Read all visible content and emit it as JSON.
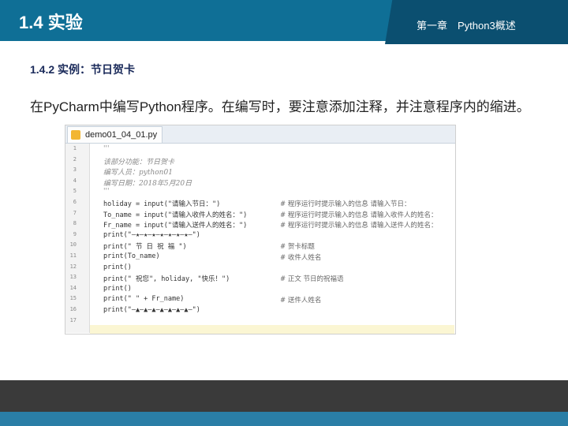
{
  "header": {
    "title": "1.4 实验",
    "chapter": "第一章　Python3概述"
  },
  "section_title": "1.4.2 实例：节日贺卡",
  "paragraph": "在PyCharm中编写Python程序。在编写时，要注意添加注释，并注意程序内的缩进。",
  "editor": {
    "tab_label": "demo01_04_01.py",
    "line_numbers": [
      "1",
      "2",
      "3",
      "4",
      "5",
      "6",
      "7",
      "8",
      "9",
      "10",
      "11",
      "12",
      "13",
      "14",
      "15",
      "16",
      "17"
    ],
    "lines": [
      {
        "code": "'''",
        "comment": ""
      },
      {
        "code": "该部分功能：节日贺卡",
        "comment": ""
      },
      {
        "code": "编写人员：python01",
        "comment": ""
      },
      {
        "code": "编写日期：2018年5月20日",
        "comment": ""
      },
      {
        "code": "'''",
        "comment": ""
      },
      {
        "code": "holiday = input(\"请输入节日：\")",
        "comment": "# 程序运行时提示输入的信息 请输入节日："
      },
      {
        "code": "To_name = input(\"请输入收件人的姓名：\")",
        "comment": "# 程序运行时提示输入的信息 请输入收件人的姓名："
      },
      {
        "code": "Fr_name = input(\"请输入送件人的姓名：\")",
        "comment": "# 程序运行时提示输入的信息 请输入送件人的姓名："
      },
      {
        "code": "print(\"—★—★—★—★—★—★—★—\")",
        "comment": ""
      },
      {
        "code": "print(\"    节    日    祝    福    \")",
        "comment": "# 贺卡标题"
      },
      {
        "code": "print(To_name)",
        "comment": "# 收件人姓名"
      },
      {
        "code": "print()",
        "comment": ""
      },
      {
        "code": "print(\"     祝您\", holiday, \"快乐！\")",
        "comment": "# 正文 节日的祝福语"
      },
      {
        "code": "print()",
        "comment": ""
      },
      {
        "code": "print(\"                    \" + Fr_name)",
        "comment": "# 送件人姓名"
      },
      {
        "code": "print(\"—▲—▲—▲—▲—▲—▲—▲—\")",
        "comment": ""
      },
      {
        "code": "",
        "comment": ""
      }
    ]
  }
}
